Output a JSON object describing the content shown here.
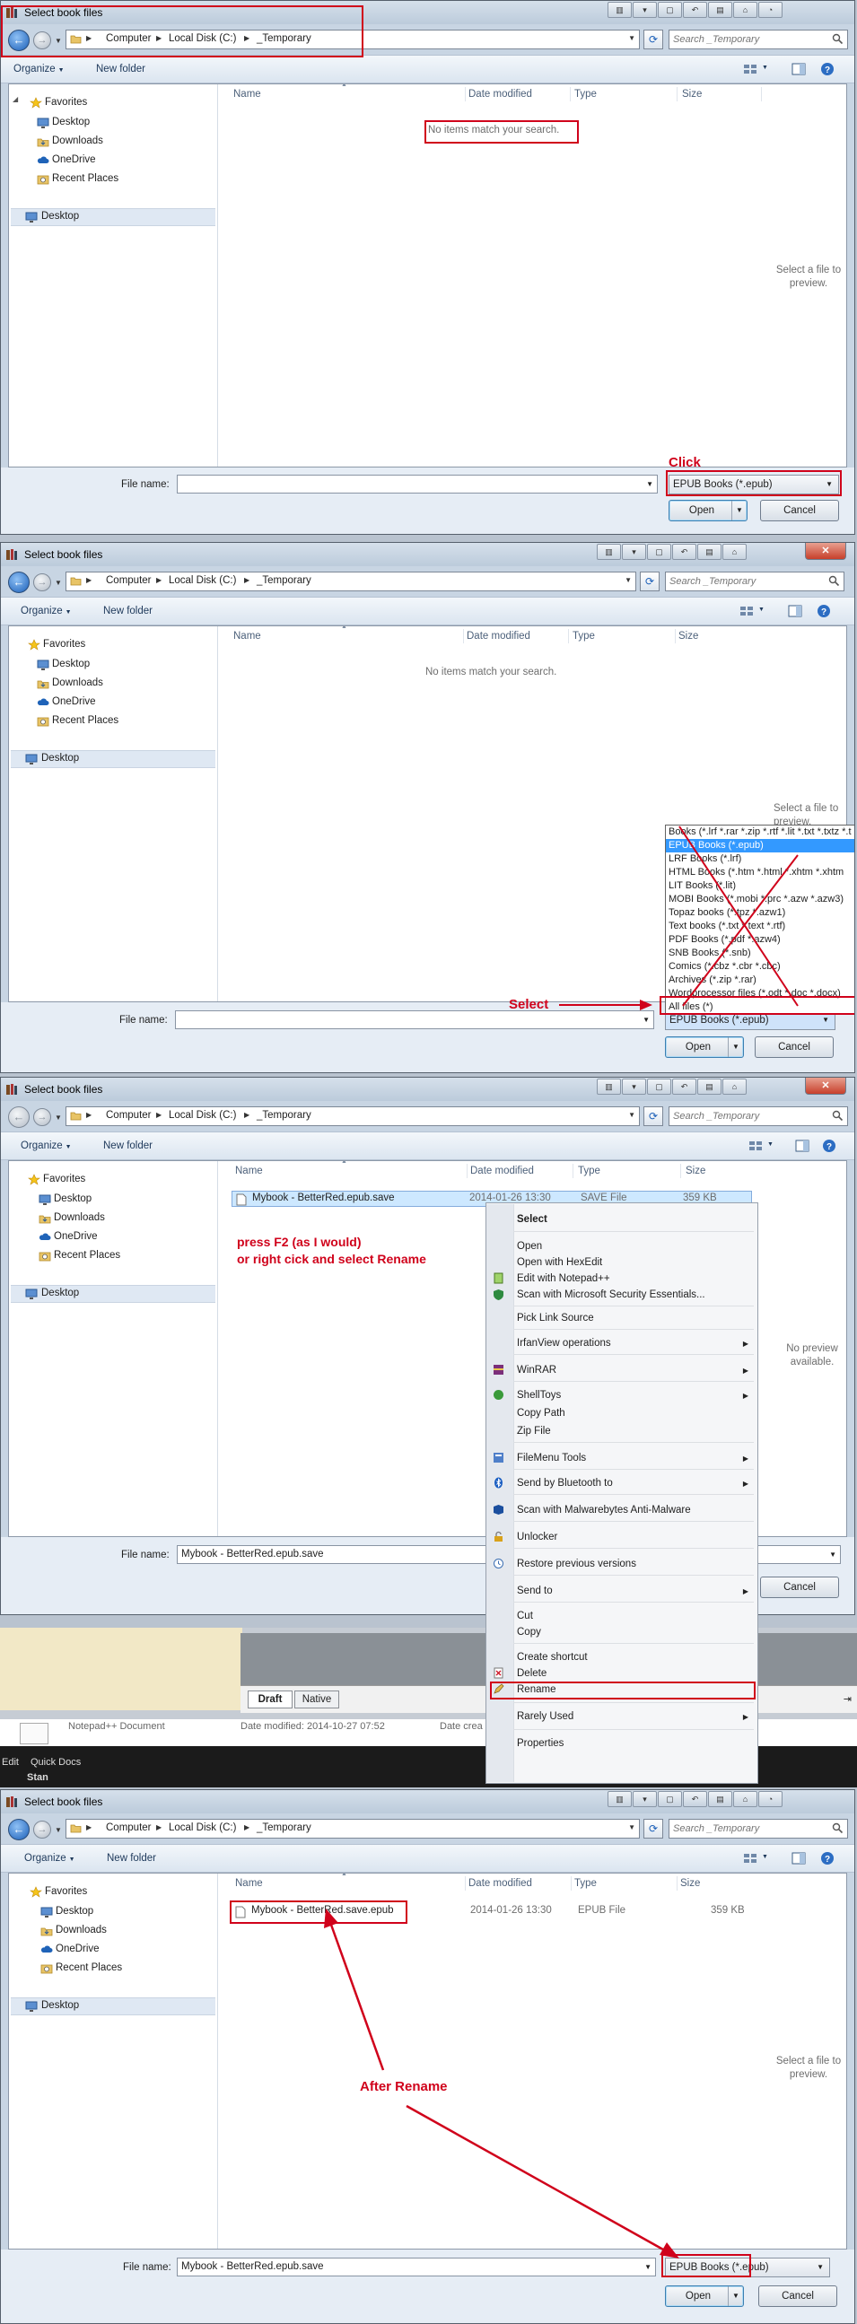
{
  "window": {
    "title": "Select book files"
  },
  "address": {
    "crumbs": [
      "Computer",
      "Local Disk (C:)",
      "_Temporary"
    ]
  },
  "search": {
    "placeholder": "Search _Temporary"
  },
  "commandbar": {
    "organize": "Organize",
    "new_folder": "New folder"
  },
  "nav": {
    "favorites": "Favorites",
    "items": [
      "Desktop",
      "Downloads",
      "OneDrive",
      "Recent Places"
    ],
    "desktop": "Desktop"
  },
  "columns": {
    "name": "Name",
    "date": "Date modified",
    "type": "Type",
    "size": "Size"
  },
  "empty_message": "No items match your search.",
  "preview": {
    "select_file": "Select a file to preview.",
    "no_preview": "No preview available."
  },
  "footer": {
    "file_name_label": "File name:",
    "filter_epub": "EPUB Books (*.epub)",
    "open": "Open",
    "cancel": "Cancel"
  },
  "panel1": {
    "annotation": "Click"
  },
  "panel2": {
    "annotation": "Select",
    "filters": [
      "Books (*.lrf *.rar *.zip *.rtf *.lit *.txt *.txtz *.t",
      "EPUB Books (*.epub)",
      "LRF Books (*.lrf)",
      "HTML Books (*.htm *.html *.xhtm *.xhtm",
      "LIT Books (*.lit)",
      "MOBI Books (*.mobi *.prc *.azw *.azw3)",
      "Topaz books (*.tpz *.azw1)",
      "Text books (*.txt *.text *.rtf)",
      "PDF Books (*.pdf *.azw4)",
      "SNB Books (*.snb)",
      "Comics (*.cbz *.cbr *.cbc)",
      "Archives (*.zip *.rar)",
      "Wordprocessor files (*.odt *.doc *.docx)",
      "All files (*)"
    ]
  },
  "panel3": {
    "file": {
      "name": "Mybook - BetterRed.epub.save",
      "date": "2014-01-26 13:30",
      "type": "SAVE File",
      "size": "359 KB"
    },
    "annotation_line1": "press F2 (as I would)",
    "annotation_line2": "or right cick and select Rename",
    "file_name_value": "Mybook - BetterRed.epub.save",
    "tabs": [
      "Draft",
      "Native"
    ],
    "behind_text": "Notepad++ Document",
    "behind_date": "Date modified: 2014-10-27 07:52",
    "behind_created": "Date crea",
    "behind_left": "Edit",
    "behind_left2": "Quick Docs",
    "behind_left3": "Stan"
  },
  "context_menu": {
    "items": [
      {
        "label": "Select",
        "bold": true
      },
      {
        "label": "Open"
      },
      {
        "label": "Open with HexEdit"
      },
      {
        "label": "Edit with Notepad++"
      },
      {
        "label": "Scan with Microsoft Security Essentials..."
      },
      {
        "label": "Pick Link Source"
      },
      {
        "label": "IrfanView operations"
      },
      {
        "label": "WinRAR"
      },
      {
        "label": "ShellToys"
      },
      {
        "label": "Copy Path"
      },
      {
        "label": "Zip File"
      },
      {
        "label": "FileMenu Tools"
      },
      {
        "label": "Send by Bluetooth to"
      },
      {
        "label": "Scan with Malwarebytes Anti-Malware"
      },
      {
        "label": "Unlocker"
      },
      {
        "label": "Restore previous versions"
      },
      {
        "label": "Send to"
      },
      {
        "label": "Cut"
      },
      {
        "label": "Copy"
      },
      {
        "label": "Create shortcut"
      },
      {
        "label": "Delete"
      },
      {
        "label": "Rename"
      },
      {
        "label": "Rarely Used"
      },
      {
        "label": "Properties"
      }
    ]
  },
  "panel4": {
    "file": {
      "name": "Mybook - BetterRed.save.epub",
      "date": "2014-01-26 13:30",
      "type": "EPUB File",
      "size": "359 KB"
    },
    "annotation": "After Rename",
    "file_name_value": "Mybook - BetterRed.epub.save"
  },
  "colors": {
    "annotation_red": "#d0021b",
    "selection_blue": "#3399ff",
    "window_frame": "#c8d5e3"
  }
}
